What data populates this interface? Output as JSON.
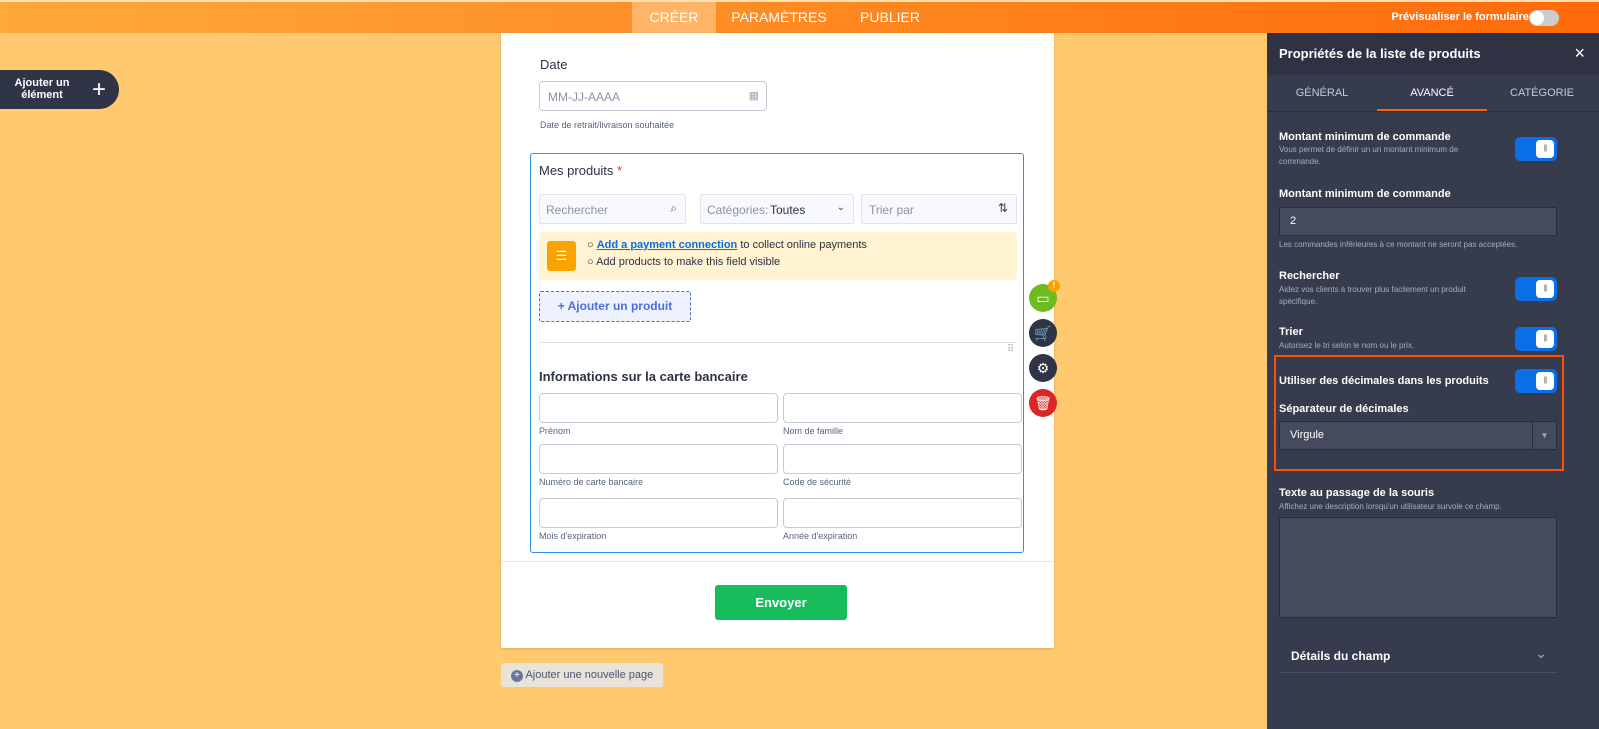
{
  "topbar": {
    "tabs": [
      "CRÉER",
      "PARAMÈTRES",
      "PUBLIER"
    ],
    "active": "CRÉER",
    "preview_label": "Prévisualiser le formulaire",
    "preview_on": false
  },
  "add_element": {
    "label": "Ajouter un élément"
  },
  "form": {
    "date": {
      "label": "Date",
      "placeholder": "MM-JJ-AAAA",
      "help": "Date de retrait/livraison souhaitée"
    },
    "products": {
      "label": "Mes produits",
      "required": "*",
      "search_placeholder": "Rechercher",
      "categories_label": "Catégories:",
      "categories_value": "Toutes",
      "sort_placeholder": "Trier par",
      "notice": {
        "link": "Add a payment connection",
        "line1_rest": " to collect online payments",
        "line2": "Add products to make this field visible"
      },
      "add_product": "+ Ajouter un produit"
    },
    "card": {
      "title": "Informations sur la carte bancaire",
      "fields": [
        "Prénom",
        "Nom de famille",
        "Numéro de carte bancaire",
        "Code de sécurité",
        "Mois d'expiration",
        "Année d'expiration"
      ]
    },
    "submit": "Envoyer",
    "add_page": "Ajouter une nouvelle page"
  },
  "side_tools": {
    "badge": "!",
    "icons": [
      "credit-card-icon",
      "cart-icon",
      "gear-icon",
      "trash-icon"
    ]
  },
  "panel": {
    "title": "Propriétés de la liste de produits",
    "tabs": [
      "GÉNÉRAL",
      "AVANCÉ",
      "CATÉGORIE"
    ],
    "active_tab": "AVANCÉ",
    "min_order": {
      "title": "Montant minimum de commande",
      "desc": "Vous permet de définir un un montant minimum de commande.",
      "on": true
    },
    "min_amount": {
      "title": "Montant minimum de commande",
      "value": "2",
      "help": "Les commandes inférieures à ce montant ne seront pas acceptées."
    },
    "search": {
      "title": "Rechercher",
      "desc": "Aidez vos clients à trouver plus facilement un produit spécifique.",
      "on": true
    },
    "sort": {
      "title": "Trier",
      "desc": "Autorisez le tri selon le nom ou le prix.",
      "on": true
    },
    "decimals": {
      "title": "Utiliser des décimales dans les produits",
      "on": true
    },
    "separator": {
      "title": "Séparateur de décimales",
      "value": "Virgule"
    },
    "hover": {
      "title": "Texte au passage de la souris",
      "desc": "Affichez une description lorsqu'un utilisateur survole ce champ.",
      "value": ""
    },
    "details": "Détails du champ"
  },
  "colors": {
    "accent": "#ff6100",
    "toggle": "#0a6ee6",
    "submit": "#18bd5b",
    "highlight": "#ff4f00"
  }
}
